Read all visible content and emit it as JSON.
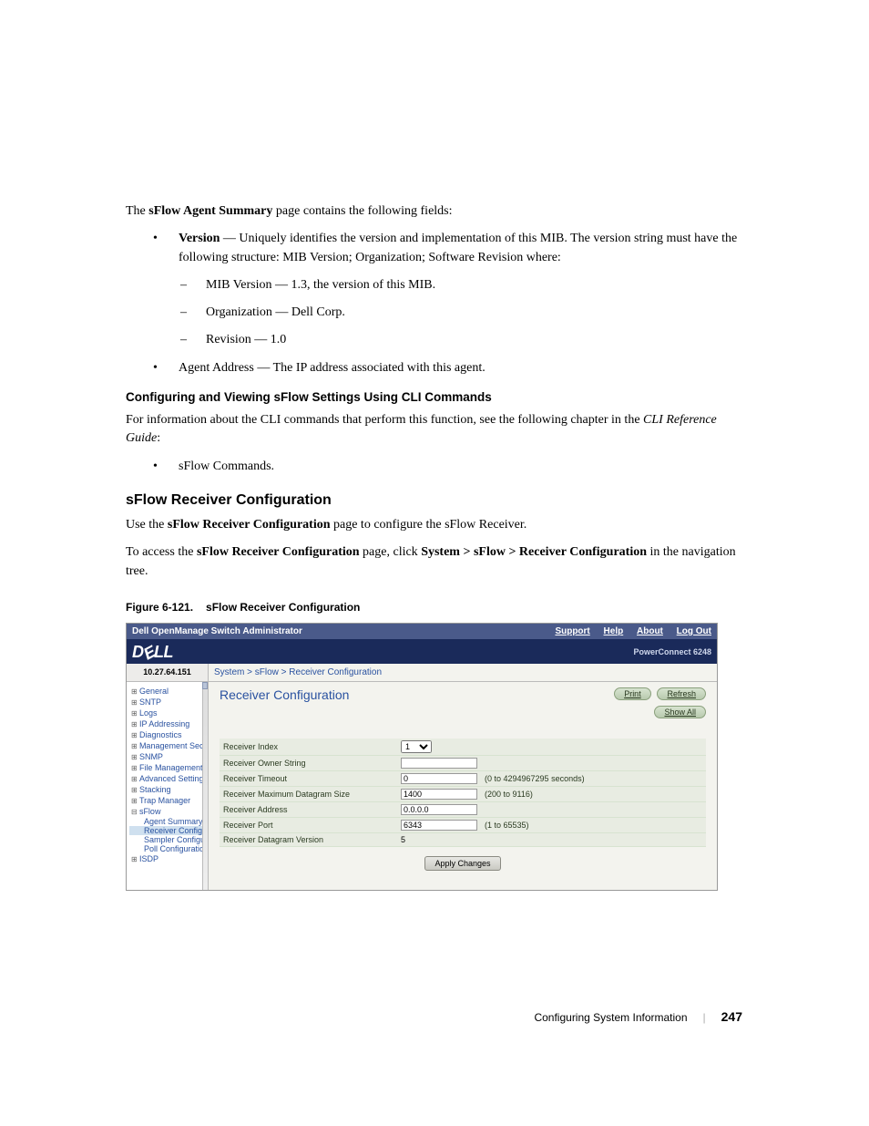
{
  "doc": {
    "intro": "The ",
    "intro_bold": "sFlow Agent Summary",
    "intro_tail": " page contains the following fields:",
    "b1_bold": "Version",
    "b1_text": " — Uniquely identifies the version and implementation of this MIB. The version string must have the following structure: MIB Version; Organization; Software Revision where:",
    "b1a": "MIB Version — 1.3, the version of this MIB.",
    "b1b": "Organization — Dell Corp.",
    "b1c": "Revision — 1.0",
    "b2": "Agent Address — The IP address associated with this agent.",
    "subhead1": "Configuring and Viewing sFlow Settings Using CLI Commands",
    "cli1a": "For information about the CLI commands that perform this function, see the following chapter in the ",
    "cli1b": "CLI Reference Guide",
    "cli1c": ":",
    "cli_bullet": "sFlow Commands.",
    "section_head": "sFlow Receiver Configuration",
    "use_a": "Use the ",
    "use_b": "sFlow Receiver Configuration",
    "use_c": " page to configure the sFlow Receiver.",
    "access_a": "To access the ",
    "access_b": "sFlow Receiver Configuration",
    "access_c": " page, click ",
    "access_d": "System > sFlow > Receiver Configuration",
    "access_e": " in the navigation tree.",
    "fig_num": "Figure 6-121.",
    "fig_title": "sFlow Receiver Configuration"
  },
  "ui": {
    "topbar_title": "Dell OpenManage Switch Administrator",
    "links": {
      "support": "Support",
      "help": "Help",
      "about": "About",
      "logout": "Log Out"
    },
    "product": "PowerConnect 6248",
    "ip": "10.27.64.151",
    "breadcrumb": {
      "a": "System",
      "b": "sFlow",
      "c": "Receiver Configuration"
    },
    "tree": {
      "general": "General",
      "sntp": "SNTP",
      "logs": "Logs",
      "ip": "IP Addressing",
      "diag": "Diagnostics",
      "mgmt": "Management Secur",
      "snmp": "SNMP",
      "filem": "File Management",
      "adv": "Advanced Settings",
      "stack": "Stacking",
      "trap": "Trap Manager",
      "sflow": "sFlow",
      "agent": "Agent Summary",
      "recv": "Receiver Configu",
      "samp": "Sampler Configur",
      "poll": "Poll Configuration",
      "isdp": "ISDP"
    },
    "content": {
      "title": "Receiver Configuration",
      "print": "Print",
      "refresh": "Refresh",
      "showall": "Show All",
      "apply": "Apply Changes",
      "rows": {
        "ridx_label": "Receiver Index",
        "ridx_value": "1",
        "rown_label": "Receiver Owner String",
        "rown_value": "",
        "rtmo_label": "Receiver Timeout",
        "rtmo_value": "0",
        "rtmo_hint": "(0 to 4294967295 seconds)",
        "rmax_label": "Receiver Maximum Datagram Size",
        "rmax_value": "1400",
        "rmax_hint": "(200 to 9116)",
        "raddr_label": "Receiver Address",
        "raddr_value": "0.0.0.0",
        "rport_label": "Receiver Port",
        "rport_value": "6343",
        "rport_hint": "(1 to 65535)",
        "rdv_label": "Receiver Datagram Version",
        "rdv_value": "5"
      }
    }
  },
  "footer": {
    "section": "Configuring System Information",
    "page": "247"
  }
}
